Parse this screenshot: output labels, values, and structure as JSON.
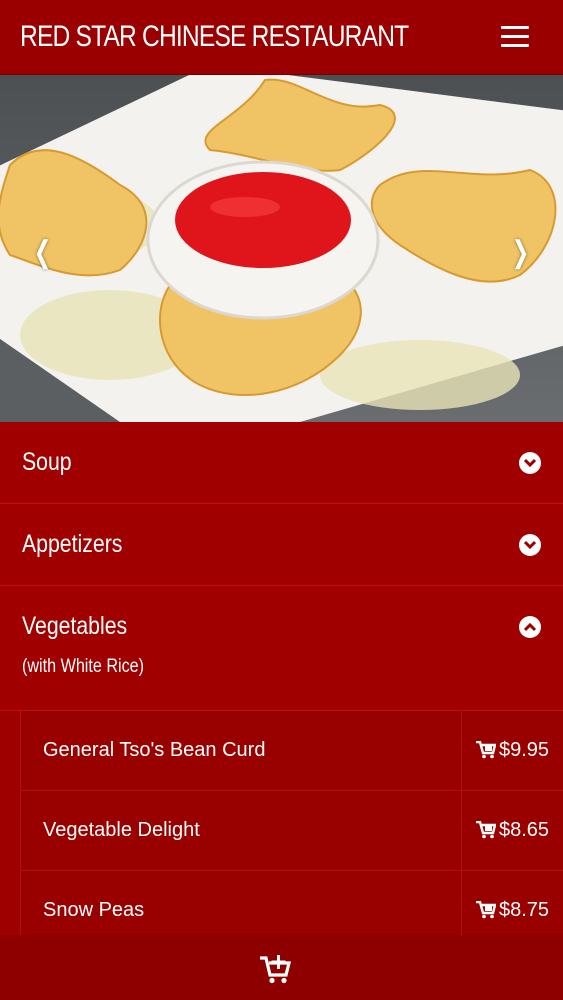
{
  "header": {
    "title": "RED STAR CHINESE RESTAURANT",
    "menu_icon": "hamburger-icon"
  },
  "carousel": {
    "slide_count": 4,
    "active_index": 3,
    "prev_icon": "chevron-left-icon",
    "next_icon": "chevron-right-icon"
  },
  "categories": [
    {
      "label": "Soup",
      "expanded": false
    },
    {
      "label": "Appetizers",
      "expanded": false
    },
    {
      "label": "Vegetables",
      "sublabel": "(with White Rice)",
      "expanded": true
    }
  ],
  "items": [
    {
      "name": "General Tso's Bean Curd",
      "price": "$9.95"
    },
    {
      "name": "Vegetable Delight",
      "price": "$8.65"
    },
    {
      "name": "Snow Peas",
      "price": "$8.75"
    }
  ],
  "footer": {
    "cart_icon": "cart-plus-icon"
  },
  "colors": {
    "brand_red": "#9e0000",
    "accent_white": "#ffffff"
  }
}
